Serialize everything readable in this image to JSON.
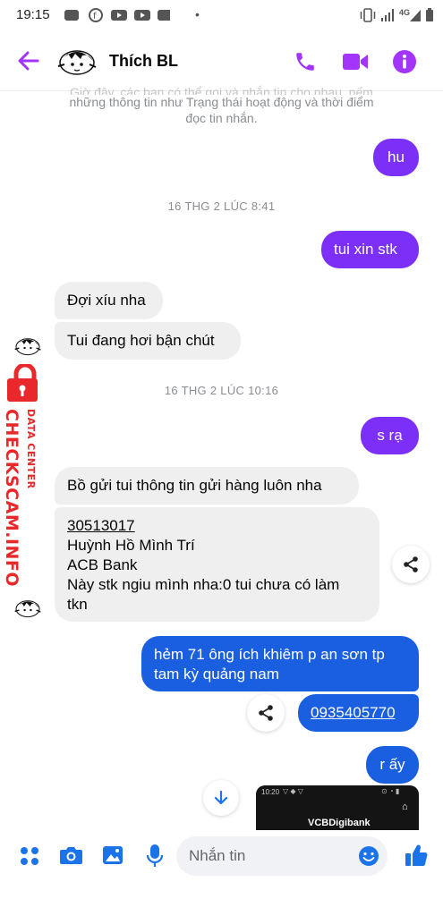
{
  "status_bar": {
    "time": "19:15",
    "network": "4G"
  },
  "header": {
    "contact_name": "Thích BL",
    "back_icon": "arrow-left-icon",
    "call_icon": "phone-icon",
    "video_icon": "video-camera-icon",
    "info_icon": "info-icon",
    "accent_color": "#a334fa"
  },
  "chat": {
    "system_notice_line1": "Giờ đây, các bạn có thể gọi và nhắn tin cho nhau, nếm",
    "system_notice_line2": "những thông tin như Trạng thái hoạt động và thời điểm",
    "system_notice_line3": "đọc tin nhắn.",
    "msg_hu": "hu",
    "timestamp_1": "16 THG 2 LÚC 8:41",
    "msg_xin_stk": "tui xin stk",
    "msg_doi_xiu": "Đợi xíu nha",
    "msg_ban_chut": "Tui đang hơi bận chút",
    "timestamp_2": "16 THG 2 LÚC 10:16",
    "msg_s_ra": "s rạ",
    "msg_bo_gui": "Bồ gửi tui thông tin gửi hàng luôn nha",
    "bank": {
      "account_number": "30513017",
      "account_name": "Huỳnh Hồ Mình Trí",
      "bank_name": "ACB Bank",
      "note_line1": "Này stk ngiu mình nha:0 tui chưa có làm",
      "note_line2": "tkn"
    },
    "msg_address_line1": "hẻm 71 ông ích khiêm p an sơn tp",
    "msg_address_line2": "tam kỳ quảng nam",
    "msg_phone": "0935405770",
    "msg_r_ay": "r ấy",
    "image_preview": {
      "time": "10:20",
      "brand": "VCBDigibank"
    },
    "outgoing_color": "#7b2ff7",
    "outgoing_color_2": "#1a5fe0"
  },
  "watermark": {
    "main": "CHECKSCAM.INFO",
    "sub": "DATA CENTER",
    "color": "#e8282b"
  },
  "composer": {
    "placeholder": "Nhắn tin",
    "icons": [
      "menu-dots-icon",
      "camera-icon",
      "image-icon",
      "microphone-icon",
      "emoji-icon",
      "thumbs-up-icon"
    ]
  }
}
